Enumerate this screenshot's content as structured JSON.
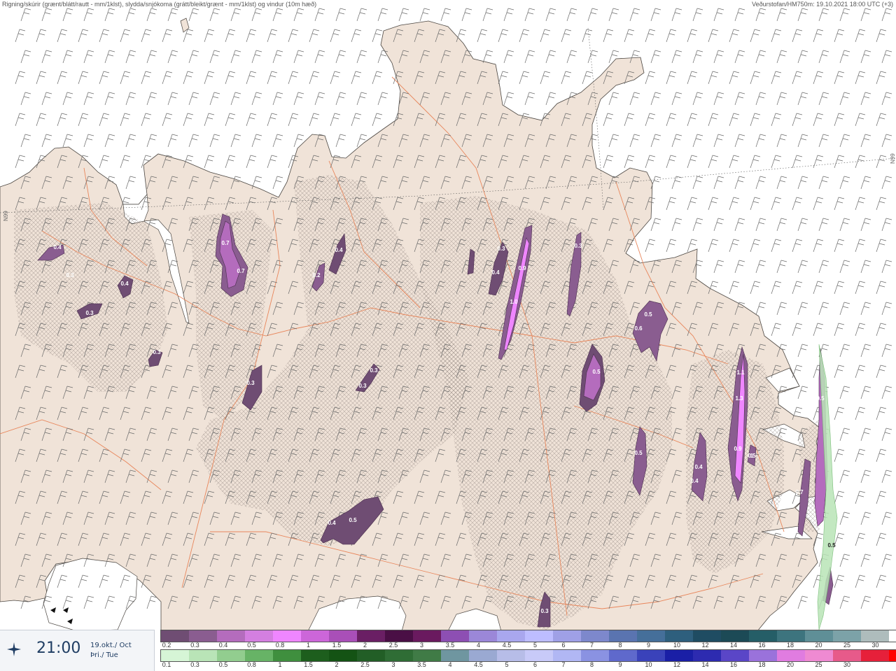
{
  "header": {
    "left_text": "Rigning/skúrir (grænt/blátt/rautt - mm/1klst), slydda/snjókoma (grátt/bleikt/grænt - mm/1klst) og vindur (10m hæð)",
    "right_text": "Veðurstofan/HM750m: 19.10.2021 18:00 UTC (+3)"
  },
  "grid_labels": {
    "left": "N99",
    "right": "N99"
  },
  "time": {
    "clock": "21:00",
    "date_is": "19.okt./ Oct",
    "day": "Þri./ Tue"
  },
  "snow_scale": {
    "colors": [
      "#6f4d73",
      "#8a5d90",
      "#b46cbd",
      "#d47fe0",
      "#ef86ff",
      "#cc66d9",
      "#a94fb8",
      "#6a1f64",
      "#4a0f45",
      "#6a1a5f",
      "#8d4fb3",
      "#9b87d8",
      "#a9a7ee",
      "#bdbdff",
      "#9fa0e6",
      "#7d88cc",
      "#5a74b0",
      "#456f9a",
      "#2e5f7d",
      "#1f4c62",
      "#1c4a56",
      "#255e67",
      "#3d747e",
      "#5f8f97",
      "#7ca2a8",
      "#aebcbc",
      "#ffffff"
    ],
    "labels": [
      "0.2",
      "0.3",
      "0.4",
      "0.5",
      "0.8",
      "1",
      "1.5",
      "2",
      "2.5",
      "3",
      "3.5",
      "4",
      "4.5",
      "5",
      "6",
      "7",
      "8",
      "9",
      "10",
      "12",
      "14",
      "16",
      "18",
      "20",
      "25",
      "30"
    ]
  },
  "rain_scale": {
    "colors": [
      "#d6f5d6",
      "#b9e4b7",
      "#92cd8f",
      "#67b366",
      "#3f8f3e",
      "#1d5e1d",
      "#145314",
      "#225e26",
      "#2f6d35",
      "#407b46",
      "#6f96a0",
      "#9aa9d2",
      "#b7bde8",
      "#c8caf8",
      "#b1b7f4",
      "#8a92e2",
      "#5f69cc",
      "#3a42ba",
      "#1a1fa6",
      "#2d2bb0",
      "#5a46c7",
      "#9a72db",
      "#e07ce0",
      "#ef8ad2",
      "#e75a8a",
      "#e6203a",
      "#ff0000"
    ],
    "labels": [
      "0.1",
      "0.3",
      "0.5",
      "0.8",
      "1",
      "1.5",
      "2",
      "2.5",
      "3",
      "3.5",
      "4",
      "4.5",
      "5",
      "6",
      "7",
      "8",
      "9",
      "10",
      "12",
      "14",
      "16",
      "18",
      "20",
      "25",
      "30"
    ]
  },
  "precip_labels": [
    "0.4",
    "0.3",
    "0.4",
    "0.3",
    "0.3",
    "0.7",
    "0.7",
    "0.4",
    "0.2",
    "0.3",
    "0.3",
    "0.3",
    "0.4",
    "0.5",
    "0.3",
    "0.4",
    "0.9",
    "1.0",
    "0.3",
    "0.5",
    "0.5",
    "0.6",
    "0.5",
    "0.4",
    "0.4",
    "1.1",
    "1.3",
    "0.9",
    "0.7",
    "0.5",
    "0.3",
    "0.5",
    "0.5",
    "1"
  ]
}
